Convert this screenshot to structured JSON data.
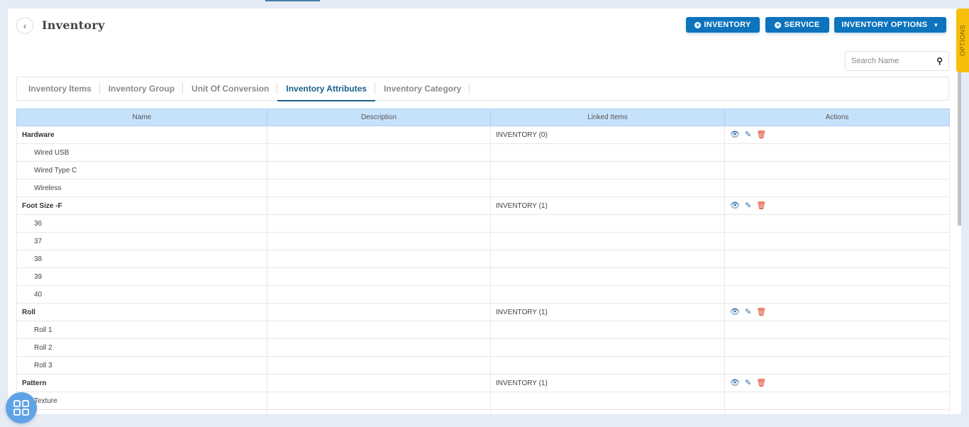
{
  "header": {
    "title": "Inventory",
    "buttons": {
      "inventory": "INVENTORY",
      "service": "SERVICE",
      "inventory_options": "INVENTORY OPTIONS"
    }
  },
  "search": {
    "placeholder": "Search Name",
    "value": ""
  },
  "tabs": [
    {
      "label": "Inventory Items",
      "active": false
    },
    {
      "label": "Inventory Group",
      "active": false
    },
    {
      "label": "Unit Of Conversion",
      "active": false
    },
    {
      "label": "Inventory Attributes",
      "active": true
    },
    {
      "label": "Inventory Category",
      "active": false
    }
  ],
  "table": {
    "columns": [
      "Name",
      "Description",
      "Linked Items",
      "Actions"
    ],
    "rows": [
      {
        "name": "Hardware",
        "type": "group",
        "description": "",
        "linked": "INVENTORY (0)"
      },
      {
        "name": "Wired USB",
        "type": "child",
        "description": "",
        "linked": ""
      },
      {
        "name": "Wired Type C",
        "type": "child",
        "description": "",
        "linked": ""
      },
      {
        "name": "Wireless",
        "type": "child",
        "description": "",
        "linked": ""
      },
      {
        "name": "Foot Size -F",
        "type": "group",
        "description": "",
        "linked": "INVENTORY (1)"
      },
      {
        "name": "36",
        "type": "child",
        "description": "",
        "linked": ""
      },
      {
        "name": "37",
        "type": "child",
        "description": "",
        "linked": ""
      },
      {
        "name": "38",
        "type": "child",
        "description": "",
        "linked": ""
      },
      {
        "name": "39",
        "type": "child",
        "description": "",
        "linked": ""
      },
      {
        "name": "40",
        "type": "child",
        "description": "",
        "linked": ""
      },
      {
        "name": "Roll",
        "type": "group",
        "description": "",
        "linked": "INVENTORY (1)"
      },
      {
        "name": "Roll 1",
        "type": "child",
        "description": "",
        "linked": ""
      },
      {
        "name": "Roll 2",
        "type": "child",
        "description": "",
        "linked": ""
      },
      {
        "name": "Roll 3",
        "type": "child",
        "description": "",
        "linked": ""
      },
      {
        "name": "Pattern",
        "type": "group",
        "description": "",
        "linked": "INVENTORY (1)"
      },
      {
        "name": "Texture",
        "type": "child",
        "description": "",
        "linked": ""
      },
      {
        "name": "",
        "type": "child",
        "description": "",
        "linked": ""
      }
    ],
    "action_icons": [
      "eye-icon",
      "edit-icon",
      "trash-icon"
    ]
  },
  "side_tab": {
    "label": "OPTIONS"
  },
  "colors": {
    "primary": "#0c73bc",
    "header_bg": "#c6e2fb",
    "active_tab": "#1a5f8f",
    "options_tab": "#f7bf0a",
    "delete": "#d93a1b"
  }
}
